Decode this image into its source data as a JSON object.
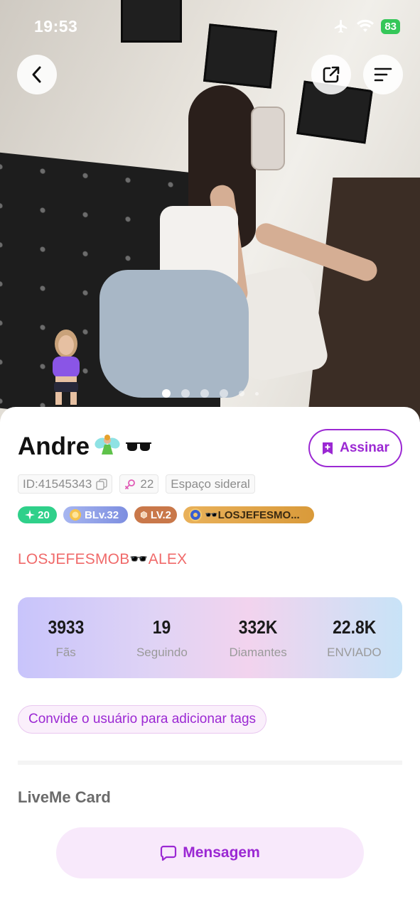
{
  "status_bar": {
    "time": "19:53",
    "battery": "83"
  },
  "profile": {
    "name": "Andre",
    "subscribe_label": "Assinar",
    "id_label": "ID:41545343",
    "gender_age": "22",
    "location": "Espaço sideral",
    "badges": {
      "level": "20",
      "bl": "BLv.32",
      "lv": "LV.2",
      "family": "🕶️LOSJEFESMO..."
    },
    "tagline": "LOSJEFESMOB🕶️ALEX",
    "stats": [
      {
        "value": "3933",
        "label": "Fãs"
      },
      {
        "value": "19",
        "label": "Seguindo"
      },
      {
        "value": "332K",
        "label": "Diamantes"
      },
      {
        "value": "22.8K",
        "label": "ENVIADO"
      }
    ],
    "invite_text": "Convide o usuário para adicionar tags",
    "card_title": "LiveMe Card",
    "message_label": "Mensagem"
  },
  "carousel": {
    "count": 6,
    "active_index": 0
  },
  "colors": {
    "accent": "#9b28d3",
    "tagline": "#f06a6a",
    "level_badge": "#2fd08a"
  }
}
